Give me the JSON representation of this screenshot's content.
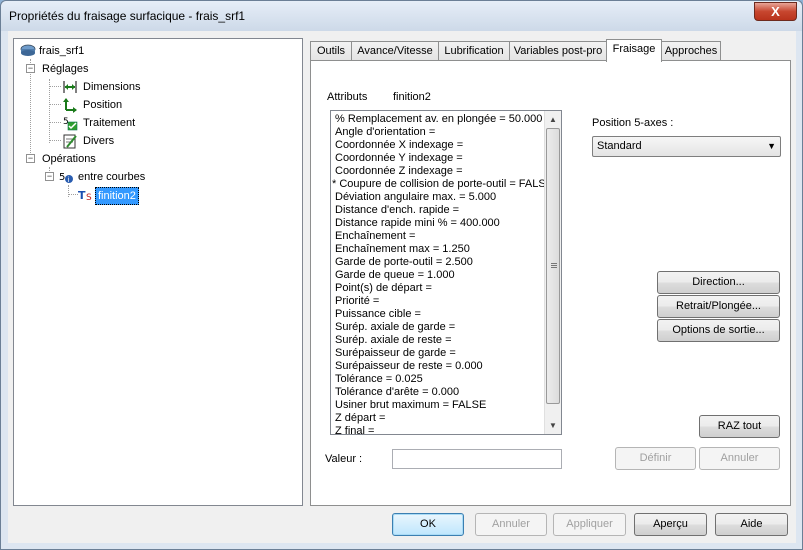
{
  "window": {
    "title": "Propriétés du fraisage surfacique - frais_srf1",
    "close_glyph": "X"
  },
  "tree": {
    "root": "frais_srf1",
    "reglages": "Réglages",
    "reglages_children": [
      "Dimensions",
      "Position",
      "Traitement",
      "Divers"
    ],
    "operations": "Opérations",
    "group": "entre courbes",
    "selected": "finition2"
  },
  "tabs": [
    "Outils",
    "Avance/Vitesse",
    "Lubrification",
    "Variables post-pro",
    "Fraisage",
    "Approches"
  ],
  "active_tab": "Fraisage",
  "panel": {
    "attributes_label": "Attributs",
    "attributes_value": "finition2",
    "attributes": [
      "% Remplacement av. en plongée = 50.000",
      "Angle d'orientation =",
      "Coordonnée X indexage =",
      "Coordonnée Y indexage =",
      "Coordonnée Z indexage =",
      "* Coupure de collision de porte-outil = FALSE",
      "Déviation angulaire max. = 5.000",
      "Distance d'ench. rapide =",
      "Distance rapide mini % = 400.000",
      "Enchaînement =",
      "Enchaînement max = 1.250",
      "Garde de porte-outil = 2.500",
      "Garde de queue = 1.000",
      "Point(s) de départ =",
      "Priorité =",
      "Puissance cible =",
      "Suréр. axiale de garde =",
      "Suréр. axiale de reste =",
      "Surépaisseur de garde =",
      "Surépaisseur de reste = 0.000",
      "Tolérance = 0.025",
      "Tolérance d'arête = 0.000",
      "Usiner brut maximum = FALSE",
      "Z départ =",
      "Z final ="
    ],
    "pos5_label": "Position 5-axes :",
    "pos5_value": "Standard",
    "btn_direction": "Direction...",
    "btn_retrait": "Retrait/Plongée...",
    "btn_options": "Options de sortie...",
    "btn_raz": "RAZ tout",
    "valeur_label": "Valeur :",
    "valeur_value": "",
    "btn_definir": "Définir",
    "btn_annuler": "Annuler"
  },
  "footer": {
    "ok": "OK",
    "annuler": "Annuler",
    "appliquer": "Appliquer",
    "apercu": "Aperçu",
    "aide": "Aide"
  }
}
